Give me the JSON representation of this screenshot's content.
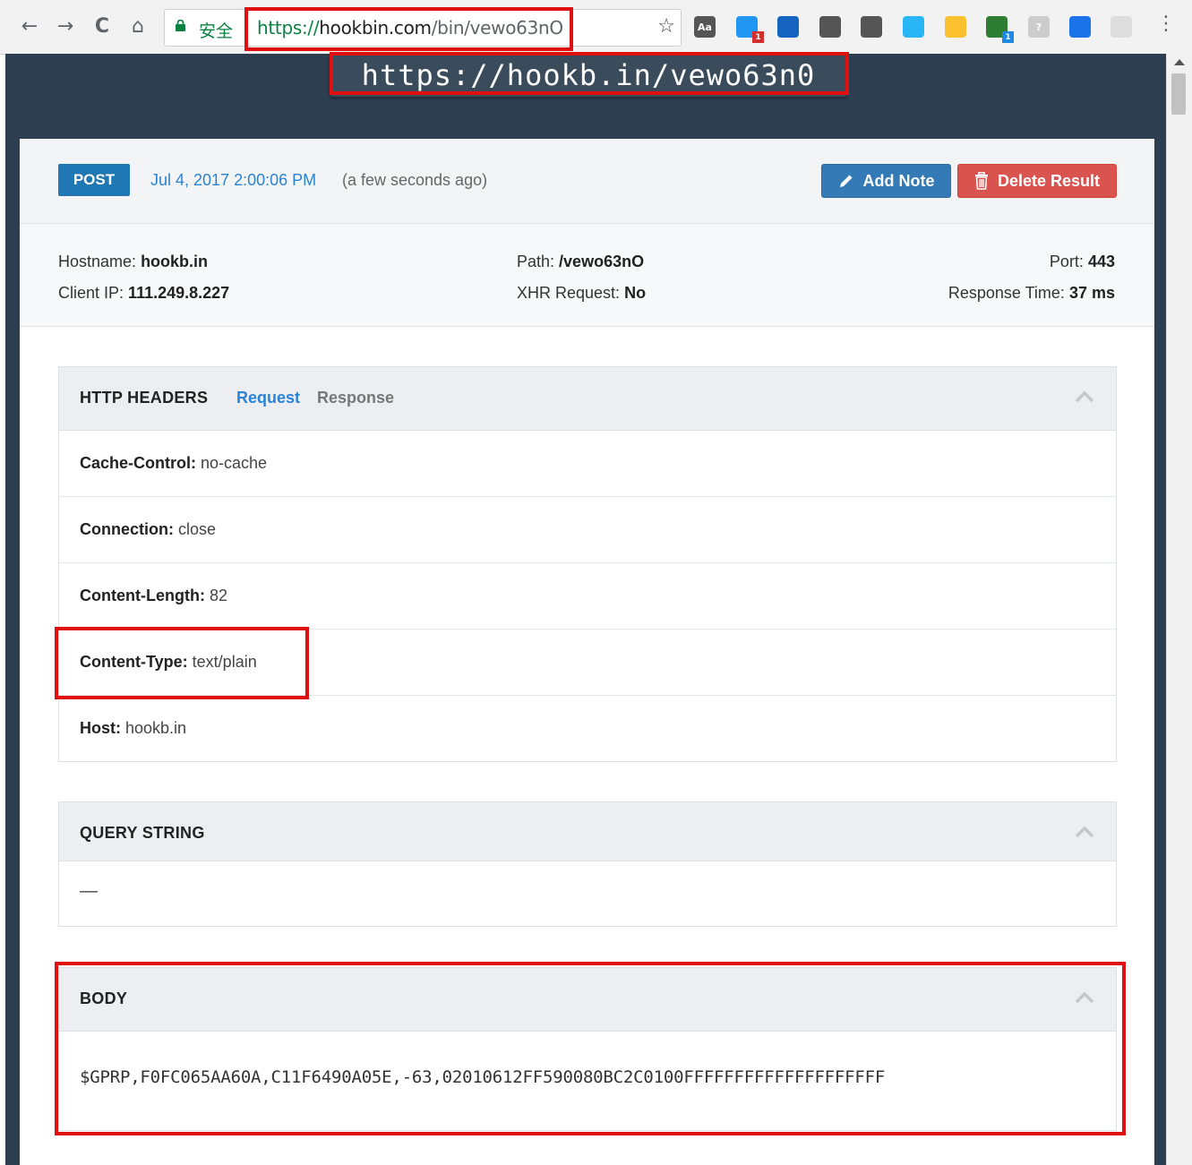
{
  "browser": {
    "back_icon": "←",
    "forward_icon": "→",
    "reload_icon": "C",
    "home_icon": "⌂",
    "secure_label": "安全",
    "url_scheme": "https://",
    "url_host": "hookbin.com",
    "url_path": "/bin/vewo63nO",
    "star_icon": "☆",
    "menu_icon": "⋮",
    "extensions": [
      {
        "name": "dictionary-extension-icon",
        "label": "Aa",
        "color": "#555555"
      },
      {
        "name": "checkmark-extension-icon",
        "label": "",
        "badge": "1",
        "badge_color": "#d32f2f",
        "color": "#2196f3"
      },
      {
        "name": "window-extension-icon",
        "label": "",
        "color": "#1565c0"
      },
      {
        "name": "pocket-extension-icon",
        "label": "",
        "color": "#555555"
      },
      {
        "name": "sync-extension-icon",
        "label": "",
        "color": "#555555"
      },
      {
        "name": "circle-extension-icon",
        "label": "",
        "color": "#29b6f6"
      },
      {
        "name": "moon-extension-icon",
        "label": "",
        "color": "#fbc02d"
      },
      {
        "name": "chat-extension-icon",
        "label": "",
        "badge": "1",
        "badge_color": "#1e88e5",
        "color": "#2e7d32"
      },
      {
        "name": "help-extension-icon",
        "label": "?",
        "color": "#cccccc"
      },
      {
        "name": "translate-extension-icon",
        "label": "",
        "color": "#1a73e8"
      },
      {
        "name": "image-extension-icon",
        "label": "",
        "color": "#dddddd"
      }
    ]
  },
  "bin_url": "https://hookb.in/vewo63n0",
  "request": {
    "method": "POST",
    "timestamp": "Jul 4, 2017 2:00:06 PM",
    "relative_time": "(a few seconds ago)",
    "add_note_label": "Add Note",
    "delete_label": "Delete Result"
  },
  "meta": {
    "hostname_label": "Hostname:",
    "hostname": "hookb.in",
    "client_ip_label": "Client IP:",
    "client_ip": "111.249.8.227",
    "path_label": "Path:",
    "path": "/vewo63nO",
    "xhr_label": "XHR Request:",
    "xhr": "No",
    "port_label": "Port:",
    "port": "443",
    "response_time_label": "Response Time:",
    "response_time": "37 ms"
  },
  "http_headers": {
    "title": "HTTP HEADERS",
    "tab_request": "Request",
    "tab_response": "Response",
    "rows": [
      {
        "key": "Cache-Control:",
        "value": "no-cache"
      },
      {
        "key": "Connection:",
        "value": "close"
      },
      {
        "key": "Content-Length:",
        "value": "82"
      },
      {
        "key": "Content-Type:",
        "value": "text/plain"
      },
      {
        "key": "Host:",
        "value": "hookb.in"
      }
    ]
  },
  "query_string": {
    "title": "QUERY STRING",
    "value": "—"
  },
  "body": {
    "title": "BODY",
    "value": "$GPRP,F0FC065AA60A,C11F6490A05E,-63,02010612FF590080BC2C0100FFFFFFFFFFFFFFFFFFFF"
  },
  "colors": {
    "page_bg": "#2d3e50",
    "method_badge": "#1f78b4",
    "link_blue": "#2b83d6",
    "add_note": "#337ab7",
    "delete": "#d9534f",
    "highlight": "#e01010"
  }
}
